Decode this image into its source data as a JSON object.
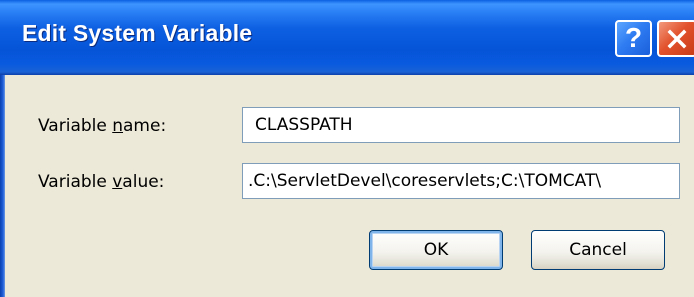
{
  "window": {
    "title": "Edit System Variable"
  },
  "titlebar_buttons": {
    "help_label": "?",
    "help_icon": "question-mark-icon",
    "close_icon": "close-x-icon"
  },
  "fields": {
    "name": {
      "label_before": "Variable ",
      "label_accel": "n",
      "label_after": "ame:",
      "value": "CLASSPATH"
    },
    "value": {
      "label_before": "Variable ",
      "label_accel": "v",
      "label_after": "alue:",
      "value": ".C:\\ServletDevel\\coreservlets;C:\\TOMCAT\\"
    }
  },
  "buttons": {
    "ok_label": "OK",
    "cancel_label": "Cancel"
  },
  "colors": {
    "titlebar": "#0554D8",
    "dialog_bg": "#ECE9D8",
    "close_button": "#E2532D",
    "help_button": "#2F7CF2",
    "input_border": "#7F9DB9",
    "button_border": "#003C74"
  }
}
